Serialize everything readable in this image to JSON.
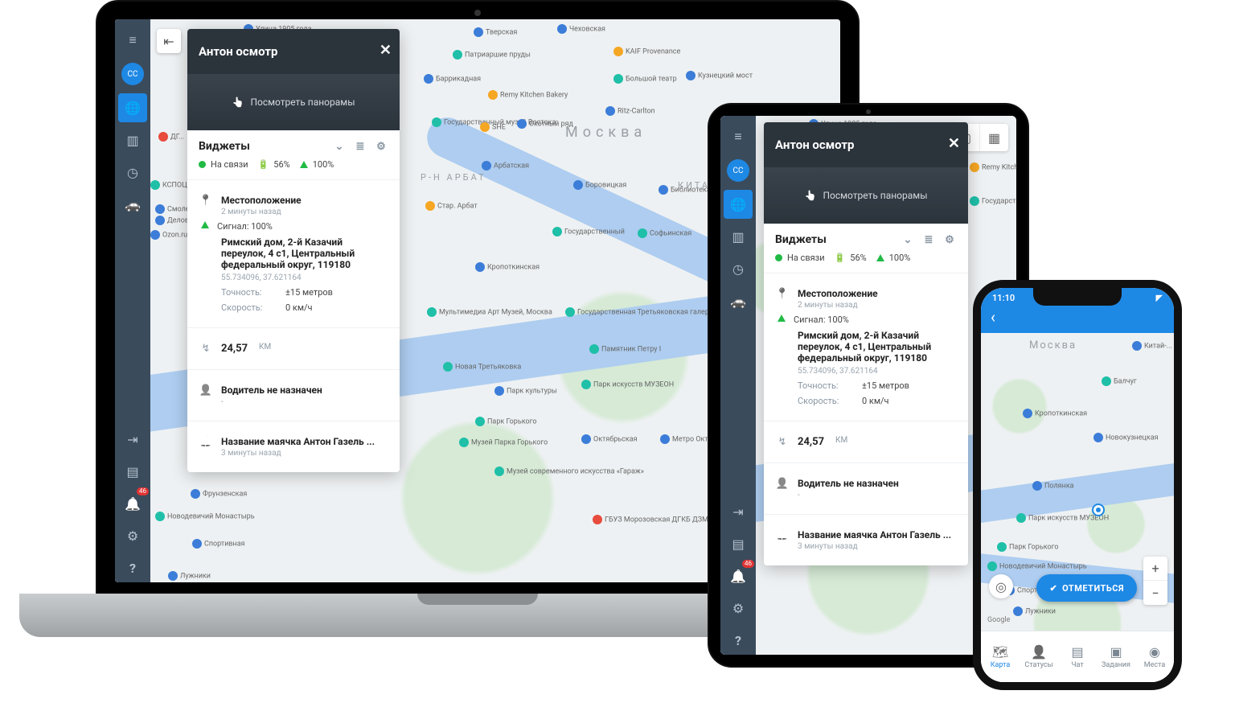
{
  "tracker": {
    "title": "Антон осмотр",
    "panorama": "Посмотреть панорамы",
    "widgets": "Виджеты",
    "status": {
      "online": "На связи",
      "battery": "56%",
      "gsm": "100%"
    },
    "loc": {
      "label": "Местоположение",
      "updated": "2 минуты назад",
      "signal": "Сигнал: 100%",
      "address": "Римский дом, 2-й Казачий переулок, 4 с1, Центральный федеральный округ, 119180",
      "coords": "55.734096, 37.621164",
      "accuracy_label": "Точность:",
      "accuracy": "±15 метров",
      "speed_label": "Скорость:",
      "speed": "0 км/ч"
    },
    "odo": {
      "value": "24,57",
      "unit": "КМ"
    },
    "driver": "Водитель не назначен",
    "beacon": {
      "title": "Название маячка Антон Газель ...",
      "updated": "3 минуты назад"
    }
  },
  "sidebar": {
    "avatar": "CC",
    "badge": "46"
  },
  "map": {
    "city": "Москва",
    "districts": [
      "Р-Н АРБАТ",
      "КИТА..."
    ],
    "poi": {
      "street1905": "Улица 1905 года",
      "tverskaya": "Тверская",
      "chehov": "Чеховская",
      "prudy": "Патриаршие пруды",
      "kaif": "KAIF Provenance",
      "remy": "Remy Kitchen Bakery",
      "barrik": "Баррикадная",
      "bolshoy": "Большой театр",
      "kuznetsk": "Кузнецкий мост",
      "vostok": "Государственный музей Востока",
      "she": "SHE",
      "ohot": "Охотный ряд",
      "arbatsk": "Арбатская",
      "borov": "Боровицкая",
      "lenin": "Библиотека имени Ленина",
      "ararat": "Стар. Арбат",
      "gosud": "Государственный",
      "krop": "Кропоткинская",
      "sofy": "Софьинская",
      "multi": "Мультимедиа Арт Музей, Москва",
      "tret": "Государственная Третьяковская галерея",
      "peter": "Памятник Петру I",
      "novtret": "Новая Третьяковка",
      "parkk": "Парк культуры",
      "parkmuz": "Парк искусств МУЗЕОН",
      "gorky": "Парк Горького",
      "gorkymus": "Музей Парка Горького",
      "oktyabr": "Октябрьская",
      "metroo": "Метро Окт...",
      "garage": "Музей современного искусства «Гараж»",
      "frunz": "Фрунзенская",
      "moroz": "ГБУЗ Морозовская ДГКБ ДЗМ",
      "mono": "Новодевичий Монастырь",
      "sport": "Спортивная",
      "luzh": "Лужники",
      "expo": "КСПОЦЕНТР",
      "ozon": "Ozon.ru",
      "delov": "Деловой це...",
      "dg": "ДГ...",
      "smol": "Смоленская",
      "ritz": "Ritz-Carlton"
    }
  },
  "phone": {
    "time": "11:10",
    "checkin": "ОТМЕТИТЬСЯ",
    "google": "Google",
    "tabs": {
      "map": "Карта",
      "status": "Статусы",
      "chat": "Чат",
      "tasks": "Задания",
      "places": "Места"
    },
    "poi": {
      "moscow": "Москва",
      "kitay": "Китай-...",
      "balchug": "Балчуг",
      "krop": "Кропоткинская",
      "novokuz": "Новокузнецкая",
      "polyanka": "Полянка",
      "parkmuz": "Парк искусств МУЗЕОН",
      "gorky": "Парк Горького",
      "mono": "Новодевичий Монастырь",
      "sport": "Спортивная",
      "luzh": "Лужники"
    }
  }
}
